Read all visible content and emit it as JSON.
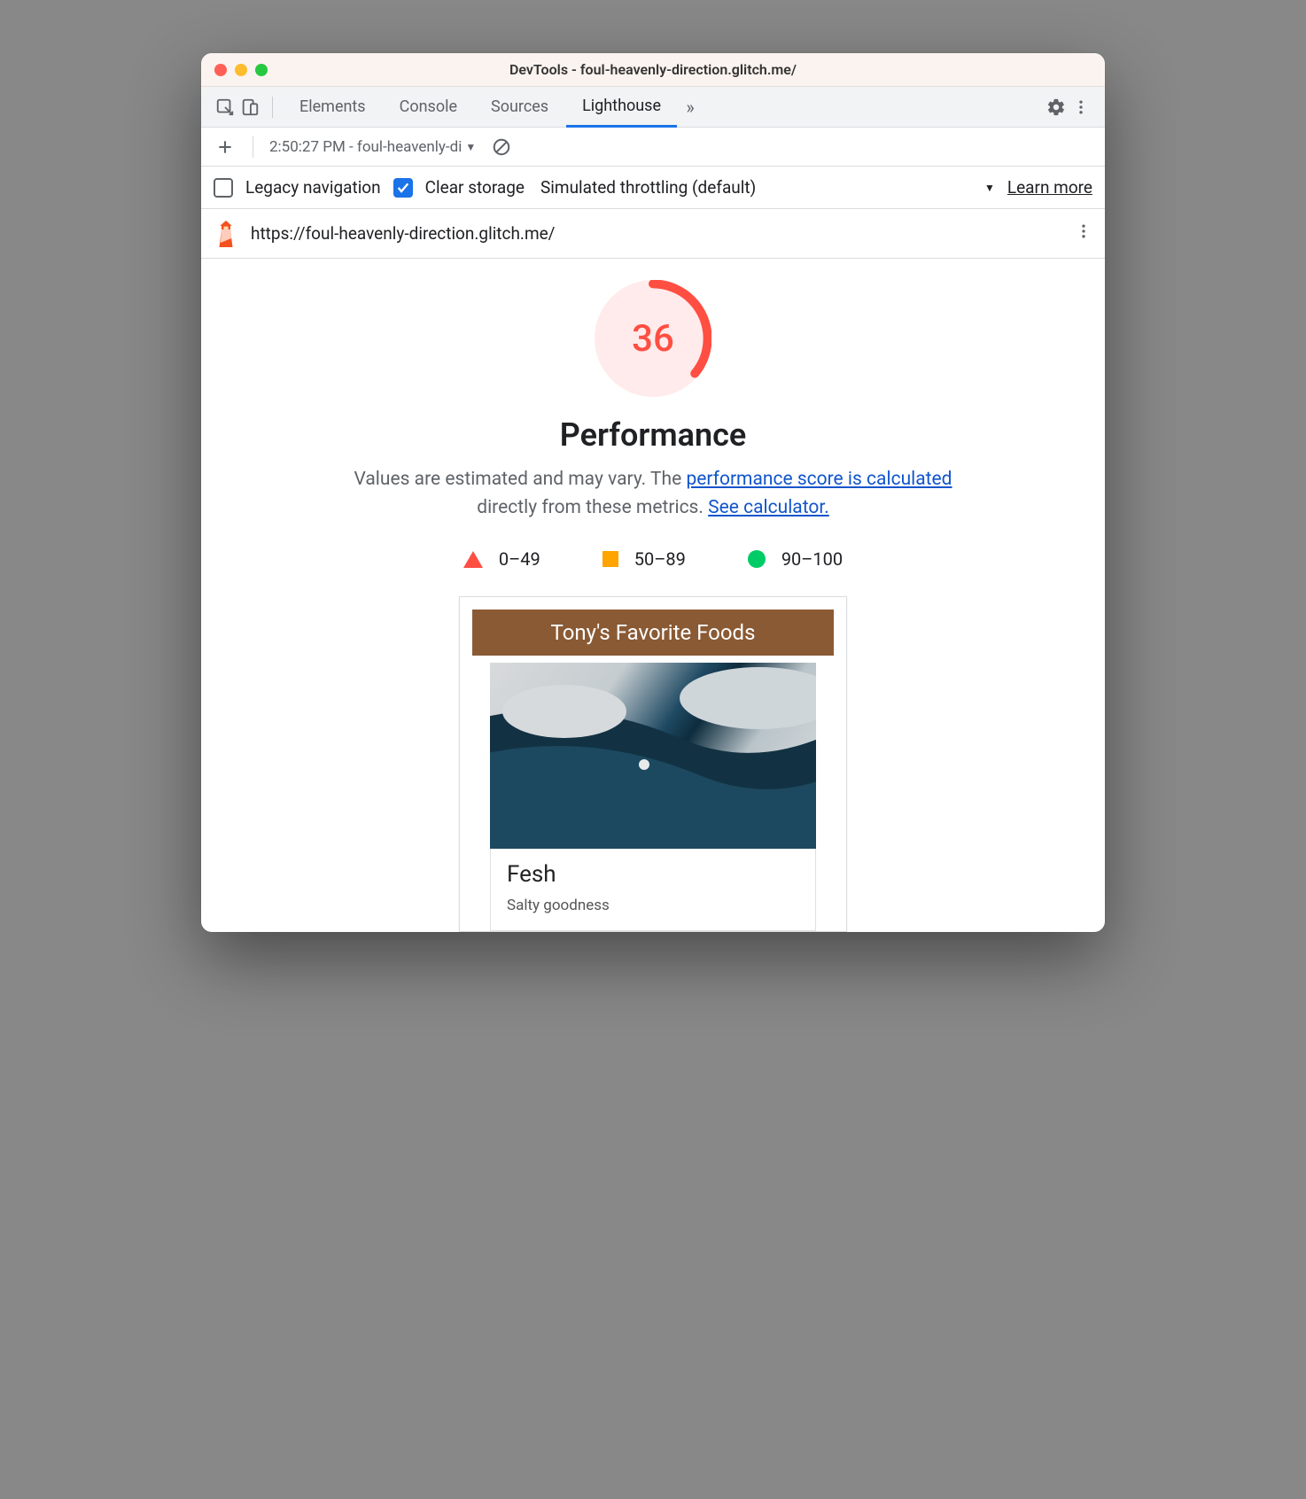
{
  "window": {
    "title": "DevTools - foul-heavenly-direction.glitch.me/"
  },
  "tabs": {
    "elements_label": "Elements",
    "console_label": "Console",
    "sources_label": "Sources",
    "lighthouse_label": "Lighthouse"
  },
  "subbar": {
    "run_selector": "2:50:27 PM - foul-heavenly-di"
  },
  "options": {
    "legacy_label": "Legacy navigation",
    "clear_label": "Clear storage",
    "throttling_label": "Simulated throttling (default)",
    "learn_label": "Learn more",
    "legacy_checked": false,
    "clear_checked": true
  },
  "url": {
    "text": "https://foul-heavenly-direction.glitch.me/"
  },
  "report": {
    "score": "36",
    "category": "Performance",
    "desc_pre": "Values are estimated and may vary. The ",
    "desc_link1": "performance score is calculated",
    "desc_mid": "directly from these metrics. ",
    "desc_link2": "See calculator.",
    "legend_fail": "0–49",
    "legend_avg": "50–89",
    "legend_pass": "90–100"
  },
  "screenshot": {
    "header": "Tony's Favorite Foods",
    "item_title": "Fesh",
    "item_sub": "Salty goodness"
  }
}
